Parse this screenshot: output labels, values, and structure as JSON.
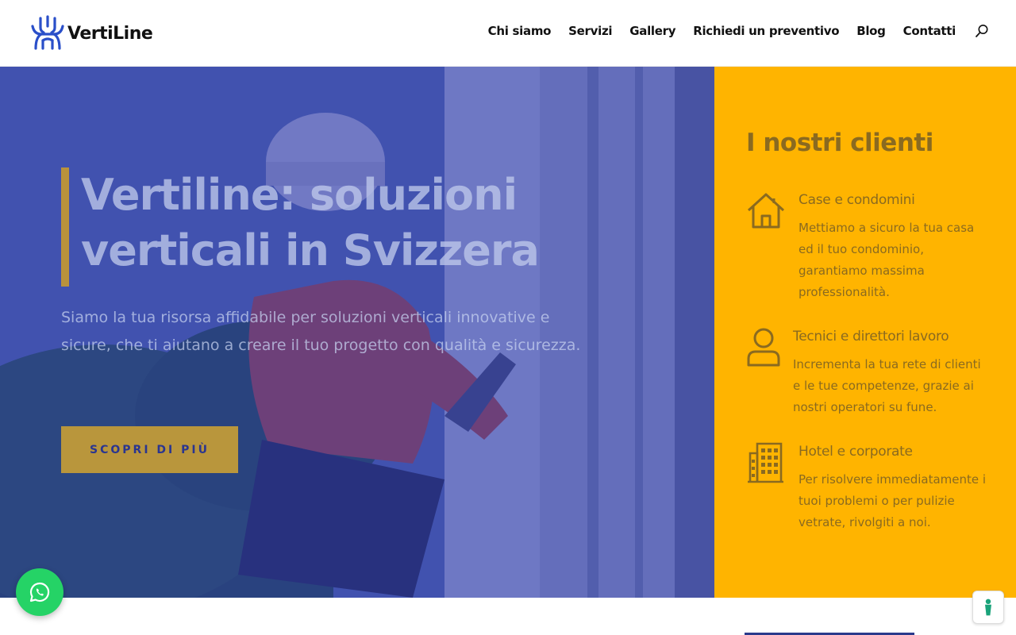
{
  "brand": {
    "name": "VertiLine",
    "accent": "#2a3a8c"
  },
  "nav": {
    "items": [
      {
        "label": "Chi siamo"
      },
      {
        "label": "Servizi"
      },
      {
        "label": "Gallery"
      },
      {
        "label": "Richiedi un preventivo"
      },
      {
        "label": "Blog"
      },
      {
        "label": "Contatti"
      }
    ],
    "search_icon": "search-icon"
  },
  "hero": {
    "title_line1": "Vertiline: soluzioni",
    "title_line2": "verticali in Svizzera",
    "text": "Siamo la tua risorsa affidabile per soluzioni verticali innovative e sicure, che ti aiutano a creare il tuo progetto con qualità e sicurezza.",
    "cta_label": "SCOPRI DI PIÙ",
    "overlay_color": "#2634aa"
  },
  "clients": {
    "title": "I nostri clienti",
    "bg_color": "#ffb400",
    "items": [
      {
        "icon": "house-icon",
        "title": "Case e condomini",
        "desc": "Mettiamo a sicuro la tua casa ed il tuo condominio, garantiamo massima professionalità."
      },
      {
        "icon": "user-icon",
        "title": "Tecnici e direttori lavoro",
        "desc": "Incrementa la tua rete di clienti e le tue competenze, grazie ai nostri operatori su fune."
      },
      {
        "icon": "building-icon",
        "title": "Hotel e corporate",
        "desc": "Per risolvere immediatamente i tuoi problemi o per pulizie vetrate, rivolgiti a noi."
      }
    ]
  },
  "widgets": {
    "whatsapp_icon": "whatsapp-icon",
    "accessibility_icon": "accessibility-icon"
  }
}
